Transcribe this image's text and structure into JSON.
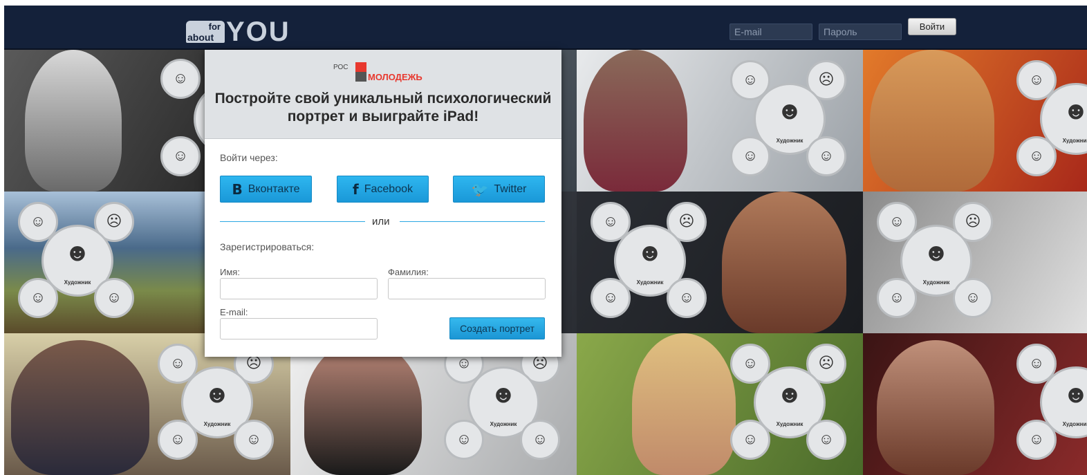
{
  "header": {
    "logo_small_top": "for",
    "logo_small_bottom": "about",
    "logo_main": "YOU",
    "email_placeholder": "E-mail",
    "password_placeholder": "Пароль",
    "login_button": "Войти"
  },
  "promo": {
    "partner_logo_prefix": "РОС",
    "partner_logo_name": "МОЛОДЕЖЬ",
    "headline": "Постройте свой уникальный психологический портрет и выиграйте iPad!"
  },
  "login_via": {
    "label": "Войти через:",
    "buttons": [
      {
        "icon": "vk-icon",
        "glyph": "В",
        "label": "Вконтакте"
      },
      {
        "icon": "facebook-icon",
        "glyph": "f",
        "label": "Facebook"
      },
      {
        "icon": "twitter-icon",
        "glyph": "🐦",
        "label": "Twitter"
      }
    ]
  },
  "divider": {
    "text": "или"
  },
  "register": {
    "label": "Зарегистрироваться:",
    "first_name_label": "Имя:",
    "last_name_label": "Фамилия:",
    "email_label": "E-mail:",
    "submit": "Создать портрет"
  },
  "background": {
    "bubble_caption": "Художник",
    "tiles": [
      {
        "bg": "#3a3a3a"
      },
      {
        "bg": "#5d6670"
      },
      {
        "bg": "#b9bcc0"
      },
      {
        "bg": "#b8401e"
      },
      {
        "bg": "#6e8a6a"
      },
      {
        "bg": "#3b3f46"
      },
      {
        "bg": "#2b2e33"
      },
      {
        "bg": "#7a7a7a"
      },
      {
        "bg": "#c9b48a"
      },
      {
        "bg": "#d4d6d8"
      },
      {
        "bg": "#6f8f3a"
      },
      {
        "bg": "#5a1c1c"
      }
    ]
  }
}
